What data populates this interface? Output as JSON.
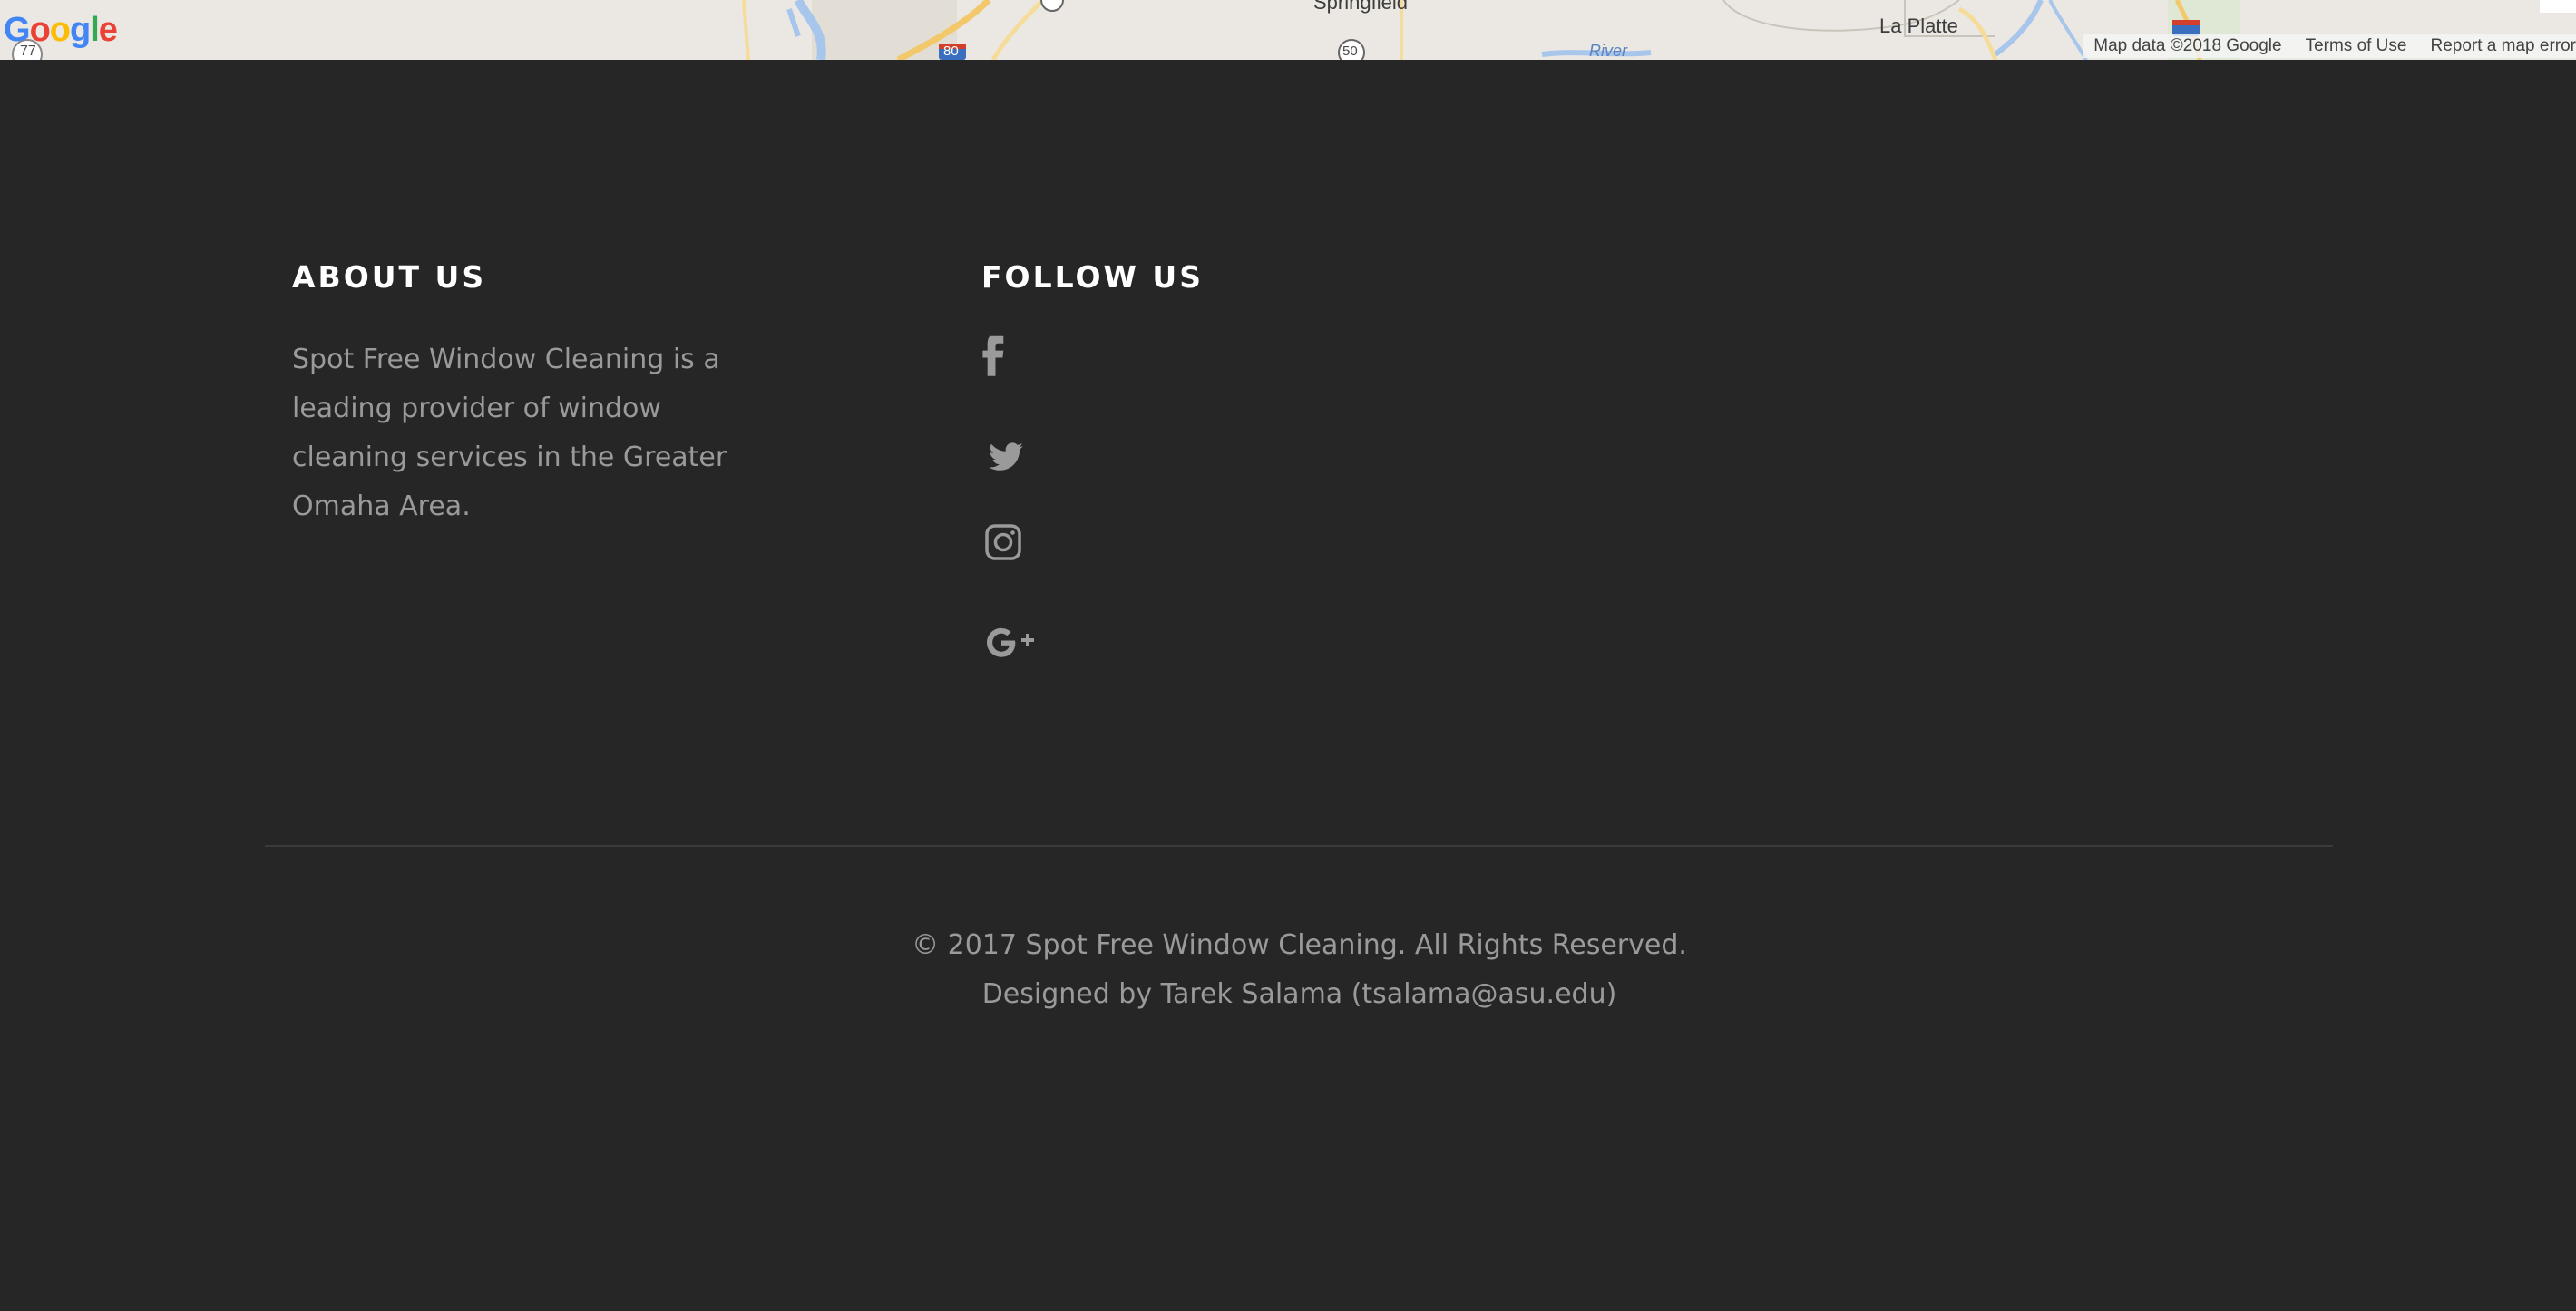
{
  "map": {
    "logo_text": "Google",
    "labels": {
      "springfield": "Springfield",
      "la_platte": "La Platte",
      "river": "River",
      "route_77": "77",
      "route_80": "80",
      "route_50": "50"
    },
    "footer": {
      "map_data": "Map data ©2018 Google",
      "terms": "Terms of Use",
      "report": "Report a map error"
    }
  },
  "about": {
    "heading": "ABOUT US",
    "text": "Spot Free Window Cleaning is a leading provider of window cleaning services in the Greater Omaha Area."
  },
  "follow": {
    "heading": "FOLLOW US",
    "links": [
      {
        "icon": "facebook-icon"
      },
      {
        "icon": "twitter-icon"
      },
      {
        "icon": "instagram-icon"
      },
      {
        "icon": "google-plus-icon"
      }
    ]
  },
  "copyright": {
    "line1": "© 2017 Spot Free Window Cleaning. All Rights Reserved.",
    "line2": "Designed by Tarek Salama (tsalama@asu.edu)"
  },
  "colors": {
    "background": "#262626",
    "heading": "#ffffff",
    "text": "#9a9a9a"
  }
}
